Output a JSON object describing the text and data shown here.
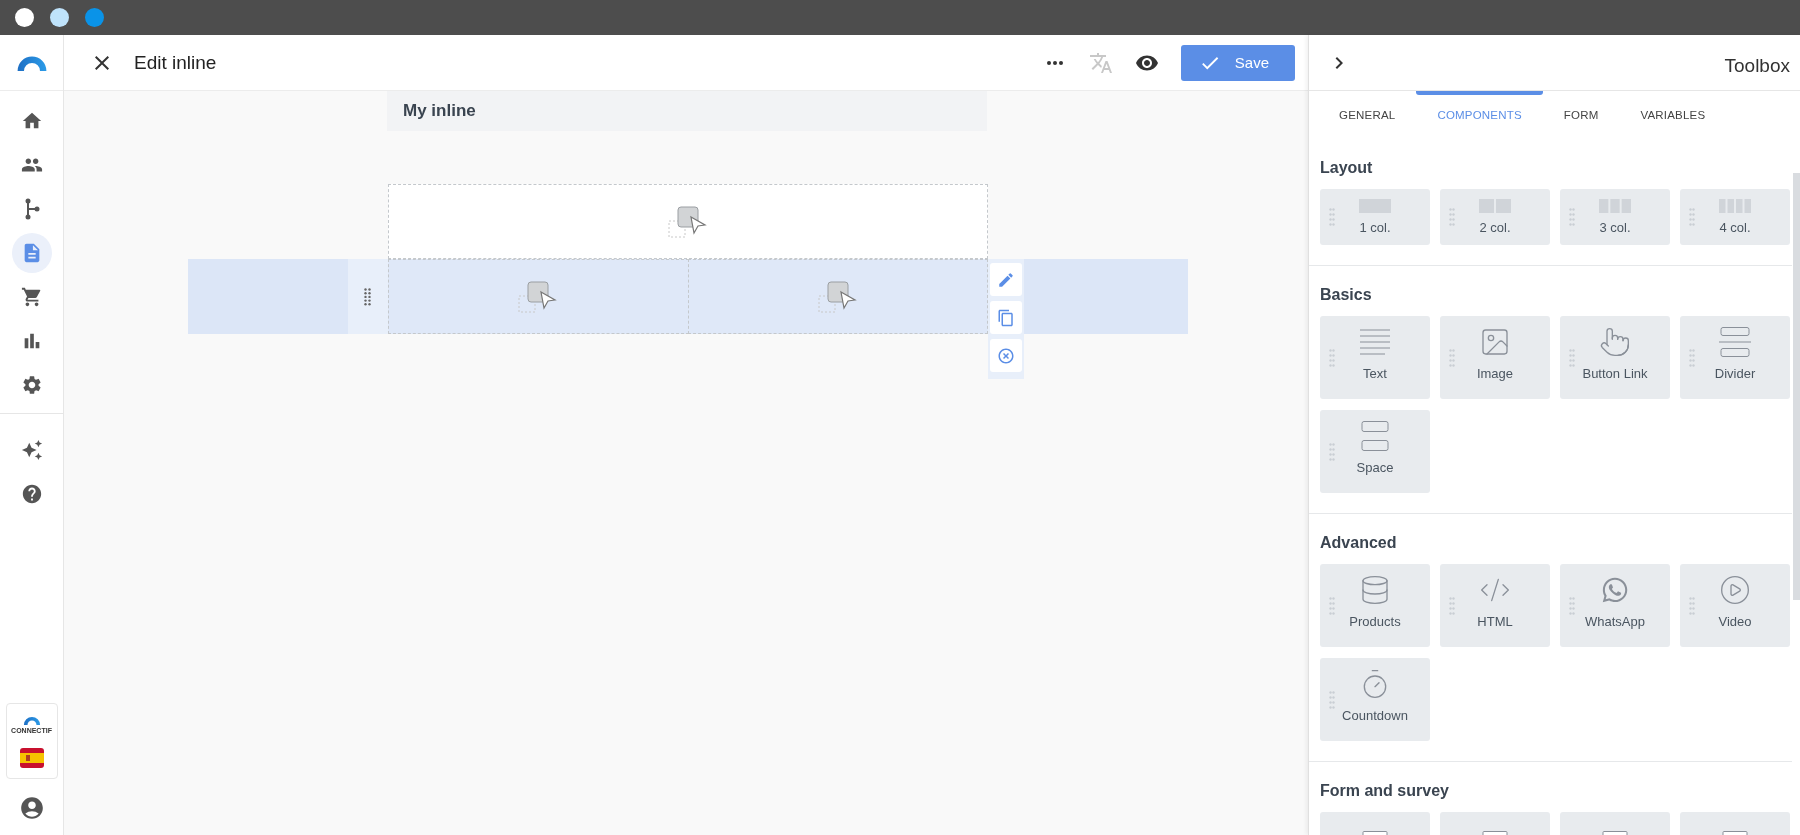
{
  "sidebar": {
    "nav": [
      {
        "selected": false
      },
      {
        "selected": false
      },
      {
        "selected": false
      },
      {
        "selected": true
      },
      {
        "selected": false
      },
      {
        "selected": false
      },
      {
        "selected": false
      }
    ],
    "extras": [
      {
        "selected": false
      },
      {
        "selected": false
      }
    ],
    "brand_label": "CONNECTIF"
  },
  "header": {
    "title": "Edit inline",
    "save_label": "Save"
  },
  "canvas": {
    "title": "My inline",
    "rows": [
      {
        "selected": false,
        "cells": [
          {
            "kind": "placeholder"
          }
        ]
      },
      {
        "selected": true,
        "cells": [
          {
            "kind": "placeholder"
          },
          {
            "kind": "placeholder"
          }
        ]
      }
    ]
  },
  "toolbox": {
    "title": "Toolbox",
    "tabs": [
      {
        "label": "GENERAL",
        "selected": false
      },
      {
        "label": "COMPONENTS",
        "selected": true
      },
      {
        "label": "FORM",
        "selected": false
      },
      {
        "label": "VARIABLES",
        "selected": false
      }
    ],
    "sections": [
      {
        "title": "Layout",
        "items": [
          {
            "label": "1 col.",
            "kind": "col1"
          },
          {
            "label": "2 col.",
            "kind": "col2"
          },
          {
            "label": "3 col.",
            "kind": "col3"
          },
          {
            "label": "4 col.",
            "kind": "col4"
          }
        ]
      },
      {
        "title": "Basics",
        "items": [
          {
            "label": "Text",
            "kind": "text"
          },
          {
            "label": "Image",
            "kind": "image"
          },
          {
            "label": "Button Link",
            "kind": "button"
          },
          {
            "label": "Divider",
            "kind": "divider"
          },
          {
            "label": "Space",
            "kind": "space"
          }
        ]
      },
      {
        "title": "Advanced",
        "items": [
          {
            "label": "Products",
            "kind": "products"
          },
          {
            "label": "HTML",
            "kind": "html"
          },
          {
            "label": "WhatsApp",
            "kind": "whatsapp"
          },
          {
            "label": "Video",
            "kind": "video"
          },
          {
            "label": "Countdown",
            "kind": "countdown"
          }
        ]
      },
      {
        "title": "Form and survey",
        "items": [
          {
            "kind": "field"
          },
          {
            "kind": "field"
          },
          {
            "kind": "field"
          },
          {
            "kind": "field"
          }
        ]
      }
    ]
  }
}
